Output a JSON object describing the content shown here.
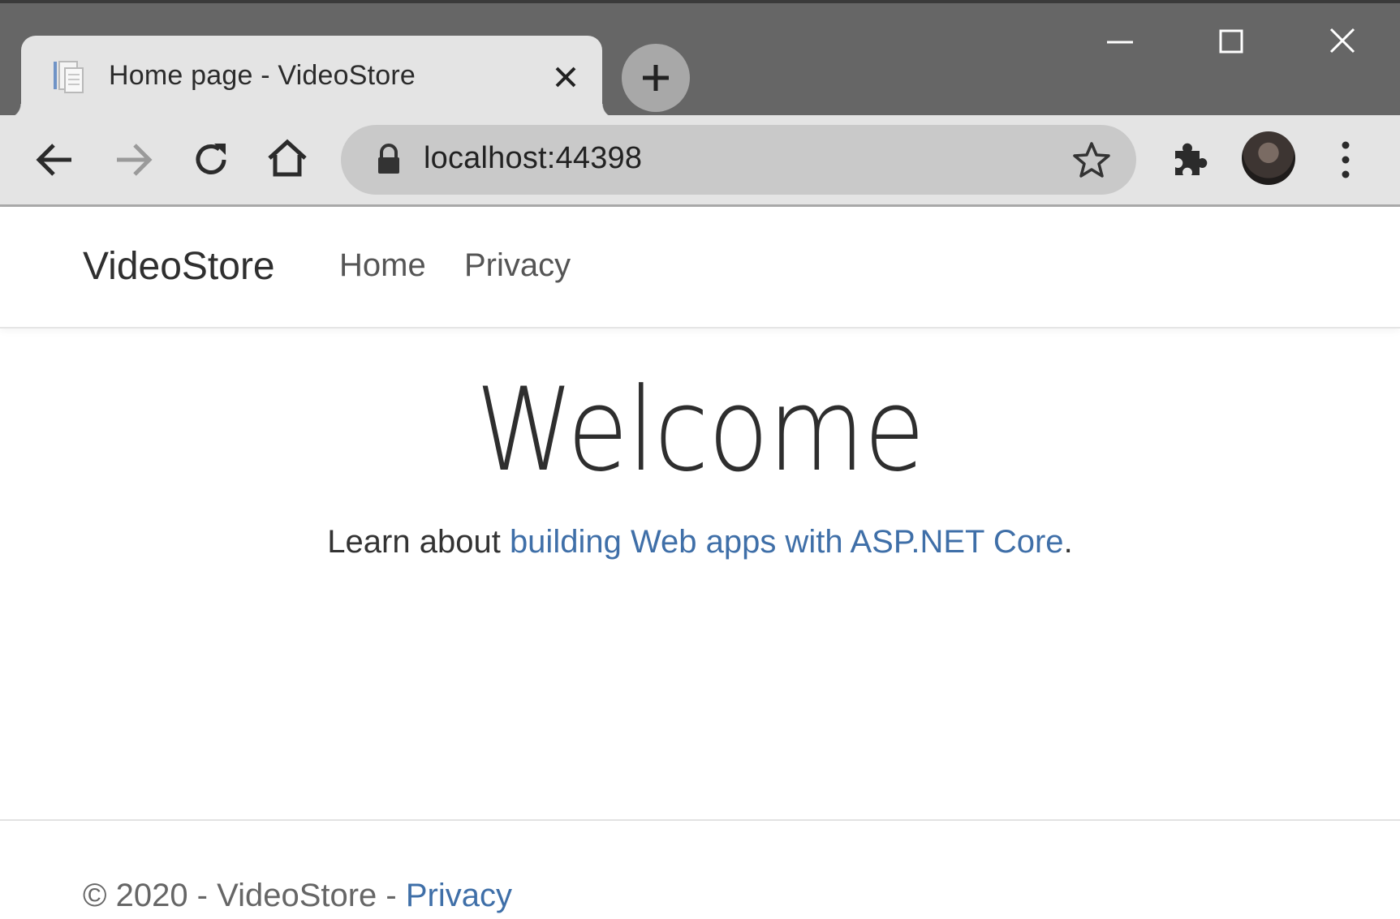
{
  "browser": {
    "tab": {
      "title": "Home page - VideoStore",
      "favicon": "page-icon",
      "close_icon": "close-icon"
    },
    "new_tab_icon": "plus-icon",
    "window_controls": [
      "minimize-icon",
      "maximize-icon",
      "close-icon"
    ],
    "toolbar": {
      "back_icon": "arrow-left-icon",
      "forward_icon": "arrow-right-icon",
      "reload_icon": "reload-icon",
      "home_icon": "home-icon",
      "url": "localhost:44398",
      "lock_icon": "lock-icon",
      "bookmark_icon": "star-icon",
      "extensions_icon": "puzzle-icon",
      "profile_icon": "avatar",
      "menu_icon": "kebab-menu-icon"
    }
  },
  "site": {
    "brand": "VideoStore",
    "nav": [
      {
        "label": "Home"
      },
      {
        "label": "Privacy"
      }
    ],
    "main": {
      "heading": "Welcome",
      "lead_prefix": "Learn about ",
      "lead_link": "building Web apps with ASP.NET Core",
      "lead_suffix": "."
    },
    "footer": {
      "text": "© 2020 - VideoStore - ",
      "privacy_link": "Privacy"
    }
  },
  "colors": {
    "link": "#3f6fa8",
    "titlebar": "#666666",
    "toolbar": "#e4e4e4"
  }
}
